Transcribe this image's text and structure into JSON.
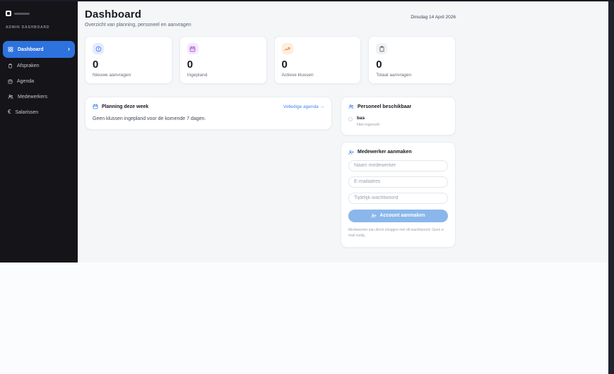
{
  "sidebar": {
    "brand": "ADMIN DASHBOARD",
    "items": [
      {
        "label": "Dashboard",
        "icon": "grid-icon",
        "active": true
      },
      {
        "label": "Afspraken",
        "icon": "clipboard-icon",
        "active": false
      },
      {
        "label": "Agenda",
        "icon": "calendar-icon",
        "active": false
      },
      {
        "label": "Medewerkers",
        "icon": "people-icon",
        "active": false
      },
      {
        "label": "Salarissen",
        "icon": "euro-icon",
        "active": false
      }
    ],
    "active_color": "#2e72de"
  },
  "header": {
    "title": "Dashboard",
    "subtitle": "Overzicht van planning, personeel en aanvragen",
    "date": "Dinsdag 14 April 2026"
  },
  "stats": [
    {
      "value": "0",
      "label": "Nieuwe aanvragen",
      "icon": "alert-circle-icon",
      "color": "#4f7df7",
      "bg": "#e4edfd"
    },
    {
      "value": "0",
      "label": "Ingepland",
      "icon": "calendar-icon",
      "color": "#a34fe0",
      "bg": "#f4e9fc"
    },
    {
      "value": "0",
      "label": "Actieve klussen",
      "icon": "trending-up-icon",
      "color": "#e8824a",
      "bg": "#fdeede"
    },
    {
      "value": "0",
      "label": "Totaal aanvragen",
      "icon": "clipboard-icon",
      "color": "#6a7280",
      "bg": "#f0f2f4"
    }
  ],
  "planning": {
    "title": "Planning deze week",
    "link_label": "Volledige agenda →",
    "empty_message": "Geen klussen ingepland voor de komende 7 dagen."
  },
  "personnel": {
    "title": "Personeel beschikbaar",
    "members": [
      {
        "name": "bas",
        "status": "Niet ingevuld"
      }
    ]
  },
  "create_employee": {
    "title": "Medewerker aanmaken",
    "name_placeholder": "Naam medewerker",
    "email_placeholder": "E-mailadres",
    "password_placeholder": "Tijdelijk wachtwoord",
    "submit_label": "Account aanmaken",
    "note": "Medewerker kan direct inloggen met dit wachtwoord. Geen e-mail nodig."
  }
}
